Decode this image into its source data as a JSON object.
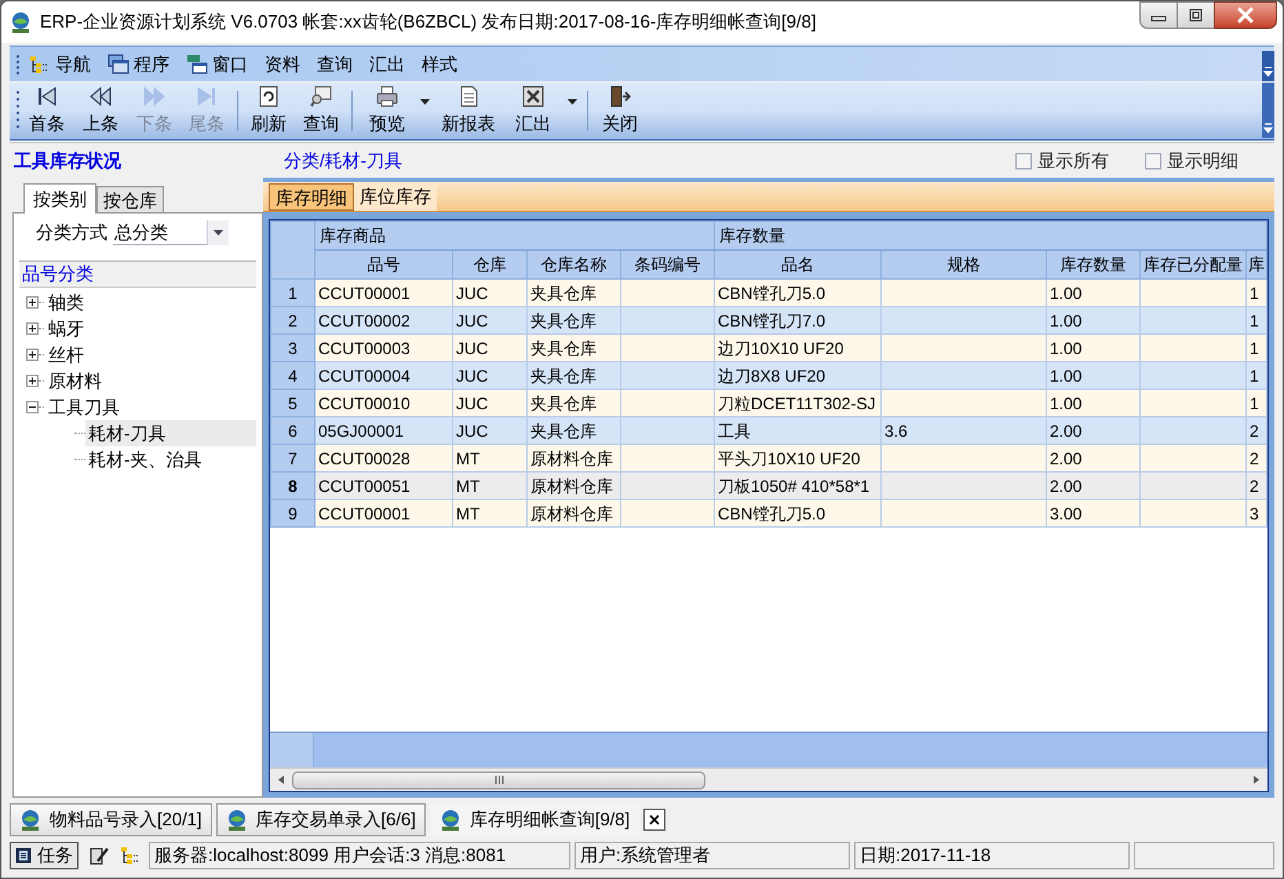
{
  "window": {
    "title": "ERP-企业资源计划系统 V6.0703 帐套:xx齿轮(B6ZBCL) 发布日期:2017-08-16-库存明细帐查询[9/8]"
  },
  "menu": [
    "导航",
    "程序",
    "窗口",
    "资料",
    "查询",
    "汇出",
    "样式"
  ],
  "toolbar": [
    {
      "label": "首条",
      "disabled": false,
      "dropdown": false
    },
    {
      "label": "上条",
      "disabled": false,
      "dropdown": false
    },
    {
      "label": "下条",
      "disabled": true,
      "dropdown": false
    },
    {
      "label": "尾条",
      "disabled": true,
      "dropdown": false
    },
    {
      "label": "刷新",
      "disabled": false,
      "dropdown": false
    },
    {
      "label": "查询",
      "disabled": false,
      "dropdown": false
    },
    {
      "label": "预览",
      "disabled": false,
      "dropdown": true
    },
    {
      "label": "新报表",
      "disabled": false,
      "dropdown": false
    },
    {
      "label": "汇出",
      "disabled": false,
      "dropdown": true
    },
    {
      "label": "关闭",
      "disabled": false,
      "dropdown": false
    }
  ],
  "panel_title": "工具库存状况",
  "path": "分类/耗材-刀具",
  "options": [
    {
      "label": "显示所有",
      "checked": false
    },
    {
      "label": "显示明细",
      "checked": false
    }
  ],
  "left_tabs": [
    {
      "label": "按类别",
      "selected": true
    },
    {
      "label": "按仓库",
      "selected": false
    }
  ],
  "classify": {
    "label": "分类方式",
    "value": "总分类"
  },
  "tree": {
    "header": "品号分类",
    "items": [
      {
        "label": "轴类",
        "expanded": false,
        "selected": false
      },
      {
        "label": "蜗牙",
        "expanded": false,
        "selected": false
      },
      {
        "label": "丝杆",
        "expanded": false,
        "selected": false
      },
      {
        "label": "原材料",
        "expanded": false,
        "selected": false
      },
      {
        "label": "工具刀具",
        "expanded": true,
        "selected": false,
        "children": [
          {
            "label": "耗材-刀具",
            "selected": true
          },
          {
            "label": "耗材-夹、治具",
            "selected": false
          }
        ]
      }
    ]
  },
  "detail_tabs": [
    {
      "label": "库存明细",
      "selected": true
    },
    {
      "label": "库位库存",
      "selected": false
    }
  ],
  "table": {
    "groups": [
      {
        "label": "库存商品",
        "columns": [
          "品号",
          "仓库",
          "仓库名称",
          "条码编号"
        ]
      },
      {
        "label": "库存数量",
        "columns": [
          "品名",
          "规格",
          "库存数量",
          "库存已分配量",
          "库"
        ]
      }
    ],
    "rows": [
      {
        "number": "1",
        "selected": false,
        "cells": [
          "CCUT00001",
          "JUC",
          "夹具仓库",
          "",
          "CBN镗孔刀5.0",
          "",
          "1.00",
          "",
          "1"
        ]
      },
      {
        "number": "2",
        "selected": false,
        "cells": [
          "CCUT00002",
          "JUC",
          "夹具仓库",
          "",
          "CBN镗孔刀7.0",
          "",
          "1.00",
          "",
          "1"
        ]
      },
      {
        "number": "3",
        "selected": false,
        "cells": [
          "CCUT00003",
          "JUC",
          "夹具仓库",
          "",
          "边刀10X10 UF20",
          "",
          "1.00",
          "",
          "1"
        ]
      },
      {
        "number": "4",
        "selected": false,
        "cells": [
          "CCUT00004",
          "JUC",
          "夹具仓库",
          "",
          "边刀8X8 UF20",
          "",
          "1.00",
          "",
          "1"
        ]
      },
      {
        "number": "5",
        "selected": false,
        "cells": [
          "CCUT00010",
          "JUC",
          "夹具仓库",
          "",
          "刀粒DCET11T302-SJ",
          "",
          "1.00",
          "",
          "1"
        ]
      },
      {
        "number": "6",
        "selected": false,
        "cells": [
          "05GJ00001",
          "JUC",
          "夹具仓库",
          "",
          "工具",
          "3.6",
          "2.00",
          "",
          "2"
        ]
      },
      {
        "number": "7",
        "selected": false,
        "cells": [
          "CCUT00028",
          "MT",
          "原材料仓库",
          "",
          "平头刀10X10 UF20",
          "",
          "2.00",
          "",
          "2"
        ]
      },
      {
        "number": "8",
        "selected": true,
        "cells": [
          "CCUT00051",
          "MT",
          "原材料仓库",
          "",
          "刀板1050# 410*58*1",
          "",
          "2.00",
          "",
          "2"
        ]
      },
      {
        "number": "9",
        "selected": false,
        "cells": [
          "CCUT00001",
          "MT",
          "原材料仓库",
          "",
          "CBN镗孔刀5.0",
          "",
          "3.00",
          "",
          "3"
        ]
      }
    ]
  },
  "doc_tabs": [
    {
      "label": "物料品号录入[20/1]",
      "selected": false
    },
    {
      "label": "库存交易单录入[6/6]",
      "selected": false
    },
    {
      "label": "库存明细帐查询[9/8]",
      "selected": true
    }
  ],
  "status_bar": {
    "task_button": "任务",
    "server": "服务器:localhost:8099 用户会话:3 消息:8081",
    "user": "用户:系统管理者",
    "date": "日期:2017-11-18"
  }
}
